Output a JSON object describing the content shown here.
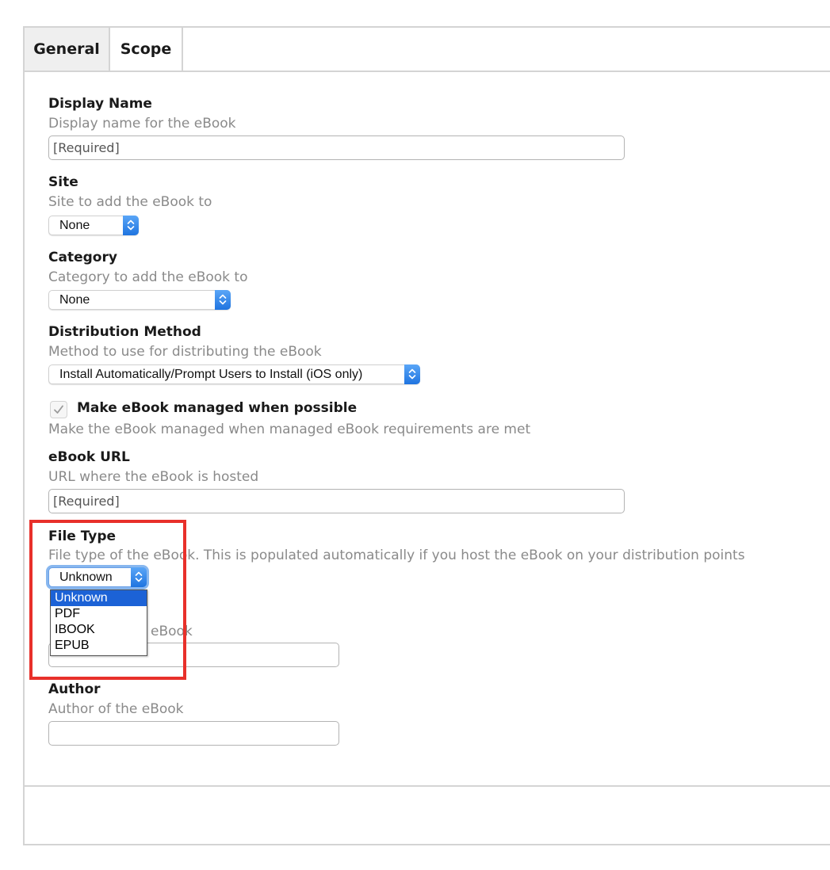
{
  "tabs": {
    "general": "General",
    "scope": "Scope"
  },
  "display_name": {
    "label": "Display Name",
    "help": "Display name for the eBook",
    "placeholder": "[Required]"
  },
  "site": {
    "label": "Site",
    "help": "Site to add the eBook to",
    "value": "None"
  },
  "category": {
    "label": "Category",
    "help": "Category to add the eBook to",
    "value": "None"
  },
  "distribution": {
    "label": "Distribution Method",
    "help": "Method to use for distributing the eBook",
    "value": "Install Automatically/Prompt Users to Install (iOS only)"
  },
  "managed": {
    "label": "Make eBook managed when possible",
    "help": "Make the eBook managed when managed eBook requirements are met",
    "checked": true
  },
  "ebook_url": {
    "label": "eBook URL",
    "help": "URL where the eBook is hosted",
    "placeholder": "[Required]"
  },
  "file_type": {
    "label": "File Type",
    "help": "File type of the eBook. This is populated automatically if you host the eBook on your distribution points",
    "value": "Unknown",
    "options": [
      "Unknown",
      "PDF",
      "IBOOK",
      "EPUB"
    ]
  },
  "version": {
    "help_fragment": "eBook"
  },
  "author": {
    "label": "Author",
    "help": "Author of the eBook"
  },
  "colors": {
    "accent": "#1f74e0",
    "highlight": "#e8302a",
    "selection": "#1c62d6"
  }
}
